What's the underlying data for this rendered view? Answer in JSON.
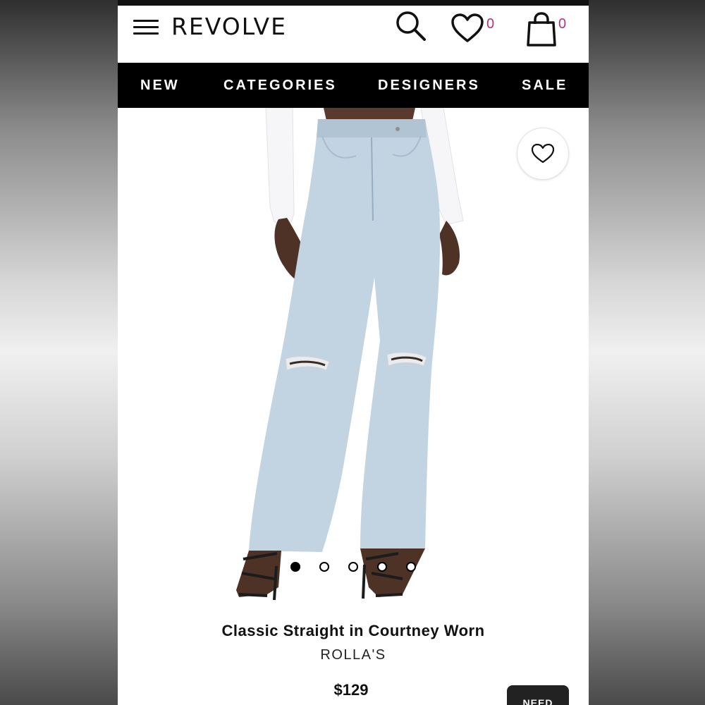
{
  "header": {
    "logo": "REVOLVE",
    "wishlist_count": "0",
    "bag_count": "0"
  },
  "nav": {
    "items": [
      {
        "label": "NEW"
      },
      {
        "label": "CATEGORIES"
      },
      {
        "label": "DESIGNERS"
      },
      {
        "label": "SALE"
      }
    ]
  },
  "gallery": {
    "image_count": 5,
    "active_index": 0
  },
  "product": {
    "title": "Classic Straight in Courtney Worn",
    "brand": "ROLLA'S",
    "price": "$129",
    "cta_label": "NEED"
  },
  "colors": {
    "accent_count": "#b0367a",
    "nav_bg": "#000000"
  }
}
